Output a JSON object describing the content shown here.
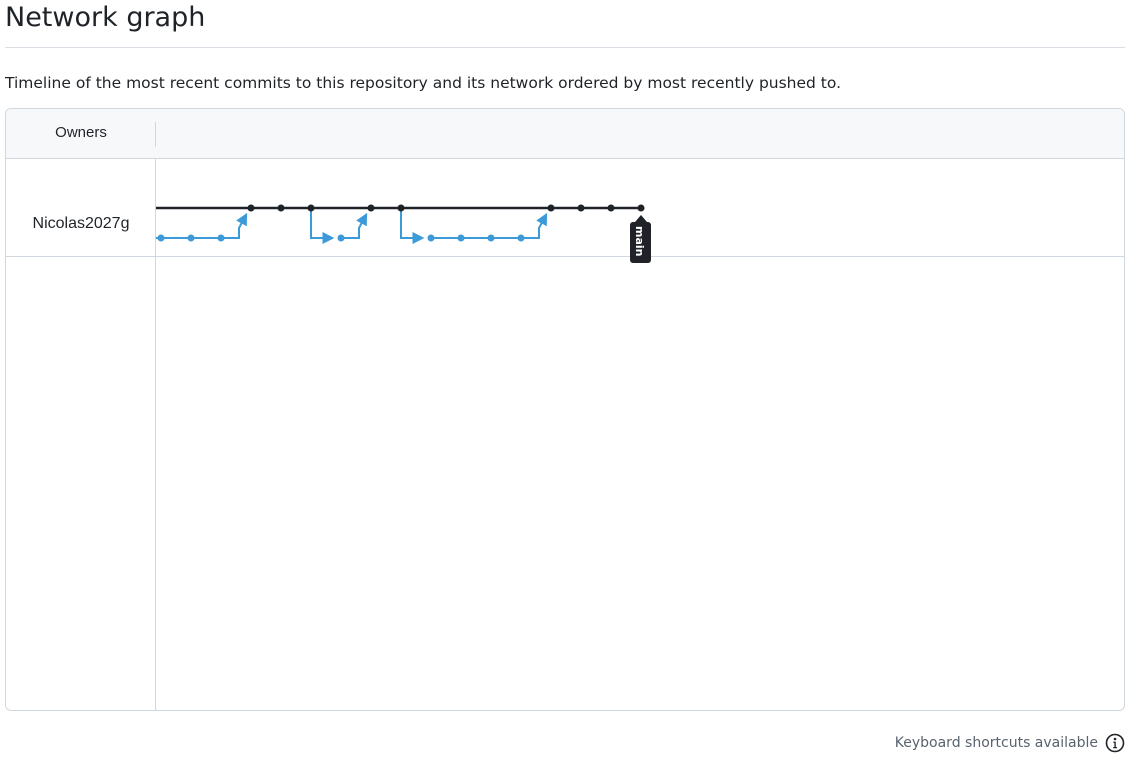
{
  "page": {
    "title": "Network graph",
    "description": "Timeline of the most recent commits to this repository and its network ordered by most recently pushed to."
  },
  "graph": {
    "owners_header": "Owners",
    "owners": [
      {
        "name": "Nicolas2027g"
      }
    ],
    "branch_label": "main",
    "main_branch_color": "#1f2328",
    "side_branch_color": "#3c9ad8",
    "main_commit_count": 11,
    "side_commit_count": 9
  },
  "footer": {
    "shortcuts_label": "Keyboard shortcuts available",
    "shortcuts_icon": "info-icon"
  }
}
